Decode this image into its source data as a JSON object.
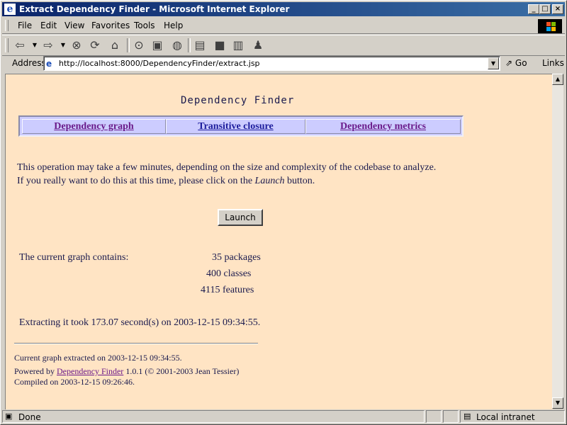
{
  "window": {
    "title": "Extract Dependency Finder - Microsoft Internet Explorer",
    "controls": {
      "minimize": "_",
      "maximize": "□",
      "close": "×"
    }
  },
  "menu": {
    "items": [
      {
        "label": "File"
      },
      {
        "label": "Edit"
      },
      {
        "label": "View"
      },
      {
        "label": "Favorites"
      },
      {
        "label": "Tools"
      },
      {
        "label": "Help"
      }
    ]
  },
  "toolbar": {
    "buttons": [
      "back-icon",
      "forward-icon",
      "stop-icon",
      "refresh-icon",
      "home-icon",
      "search-icon",
      "favorites-icon",
      "history-icon",
      "print-icon",
      "edit-icon",
      "discuss-icon",
      "messenger-icon"
    ]
  },
  "address": {
    "label": "Address",
    "url": "http://localhost:8000/DependencyFinder/extract.jsp",
    "go": "Go",
    "links": "Links"
  },
  "page": {
    "title": "Dependency Finder",
    "nav": [
      {
        "label": "Dependency graph"
      },
      {
        "label": "Transitive closure"
      },
      {
        "label": "Dependency metrics"
      }
    ],
    "message_line1": "This operation may take a few minutes, depending on the size and complexity of the codebase to analyze.",
    "message_line2_pre": "If you really want to do this at this time, please click on the",
    "message_line2_em": "Launch",
    "message_line2_post": "button.",
    "launch_button": "Launch",
    "graph_label": "The current graph contains:",
    "packages": "35 packages",
    "classes": "400 classes",
    "features": "4115 features",
    "extract_time": "Extracting it took 173.07 second(s) on 2003-12-15 09:34:55.",
    "footer": {
      "extracted": "Current graph extracted on 2003-12-15 09:34:55.",
      "powered_pre": "Powered by",
      "powered_link": "Dependency Finder",
      "powered_post": "1.0.1 (© 2001-2003 Jean Tessier)",
      "compiled": "Compiled on 2003-12-15 09:26:46."
    }
  },
  "status": {
    "text": "Done",
    "zone": "Local intranet"
  },
  "colors": {
    "page_background": "#ffe4c4",
    "nav_background": "#ccccff",
    "link": "#1c1c9c",
    "visited_link": "#6a1a8a",
    "title_bar": "#0a246a"
  }
}
